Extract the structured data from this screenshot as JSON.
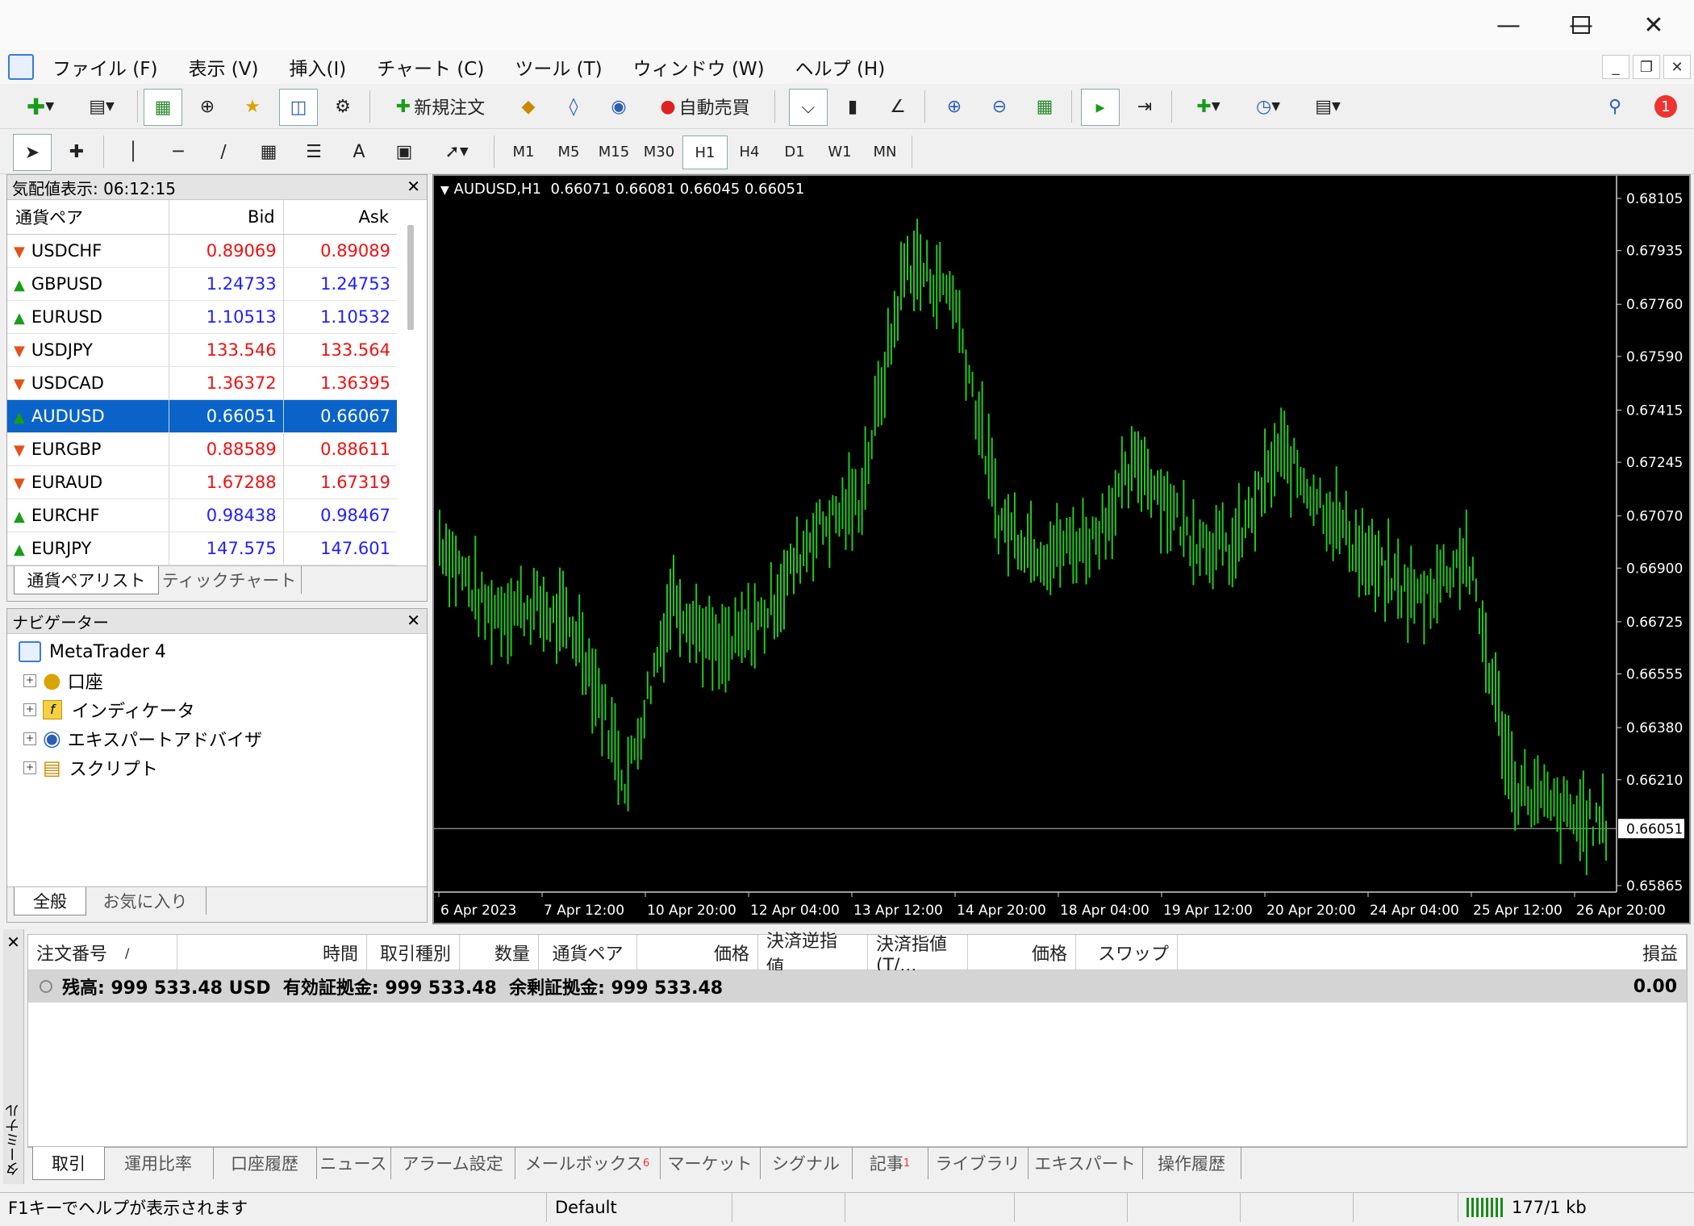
{
  "menu": [
    "ファイル (F)",
    "表示 (V)",
    "挿入(I)",
    "チャート (C)",
    "ツール (T)",
    "ウィンドウ (W)",
    "ヘルプ (H)"
  ],
  "toolbar": {
    "new_order": "新規注文",
    "auto_trade": "自動売買",
    "notification_count": "1",
    "timeframes": [
      "M1",
      "M5",
      "M15",
      "M30",
      "H1",
      "H4",
      "D1",
      "W1",
      "MN"
    ],
    "active_timeframe": "H1",
    "text_tool": "A"
  },
  "market_watch": {
    "title": "気配値表示: 06:12:15",
    "columns": [
      "通貨ペア",
      "Bid",
      "Ask"
    ],
    "rows": [
      {
        "symbol": "USDCHF",
        "bid": "0.89069",
        "ask": "0.89089",
        "dir": "down"
      },
      {
        "symbol": "GBPUSD",
        "bid": "1.24733",
        "ask": "1.24753",
        "dir": "up"
      },
      {
        "symbol": "EURUSD",
        "bid": "1.10513",
        "ask": "1.10532",
        "dir": "up"
      },
      {
        "symbol": "USDJPY",
        "bid": "133.546",
        "ask": "133.564",
        "dir": "down"
      },
      {
        "symbol": "USDCAD",
        "bid": "1.36372",
        "ask": "1.36395",
        "dir": "down"
      },
      {
        "symbol": "AUDUSD",
        "bid": "0.66051",
        "ask": "0.66067",
        "dir": "up",
        "selected": true
      },
      {
        "symbol": "EURGBP",
        "bid": "0.88589",
        "ask": "0.88611",
        "dir": "down"
      },
      {
        "symbol": "EURAUD",
        "bid": "1.67288",
        "ask": "1.67319",
        "dir": "down"
      },
      {
        "symbol": "EURCHF",
        "bid": "0.98438",
        "ask": "0.98467",
        "dir": "up"
      },
      {
        "symbol": "EURJPY",
        "bid": "147.575",
        "ask": "147.601",
        "dir": "up"
      }
    ],
    "tabs": [
      "通貨ペアリスト",
      "ティックチャート"
    ]
  },
  "navigator": {
    "title": "ナビゲーター",
    "root": "MetaTrader 4",
    "items": [
      "口座",
      "インディケータ",
      "エキスパートアドバイザ",
      "スクリプト"
    ],
    "tabs": [
      "全般",
      "お気に入り"
    ]
  },
  "chart": {
    "header": "AUDUSD,H1  0.66071 0.66081 0.66045 0.66051",
    "current_price": "0.66051",
    "price_labels": [
      "0.68105",
      "0.67935",
      "0.67760",
      "0.67590",
      "0.67415",
      "0.67245",
      "0.67070",
      "0.66900",
      "0.66725",
      "0.66555",
      "0.66380",
      "0.66210",
      "0.66051",
      "0.65865"
    ],
    "time_labels": [
      "6 Apr 2023",
      "7 Apr 12:00",
      "10 Apr 20:00",
      "12 Apr 04:00",
      "13 Apr 12:00",
      "14 Apr 20:00",
      "18 Apr 04:00",
      "19 Apr 12:00",
      "20 Apr 20:00",
      "24 Apr 04:00",
      "25 Apr 12:00",
      "26 Apr 20:00"
    ],
    "bar_color": "#22c822",
    "background": "#000000"
  },
  "chart_data": {
    "type": "line",
    "symbol": "AUDUSD",
    "timeframe": "H1",
    "ylim": [
      0.65865,
      0.68105
    ],
    "x": [
      "6 Apr 2023",
      "7 Apr 12:00",
      "10 Apr 20:00",
      "12 Apr 04:00",
      "13 Apr 12:00",
      "14 Apr 20:00",
      "18 Apr 04:00",
      "19 Apr 12:00",
      "20 Apr 20:00",
      "24 Apr 04:00",
      "25 Apr 12:00",
      "26 Apr 20:00"
    ],
    "series": [
      {
        "values": [
          0.67,
          0.6676,
          0.6678,
          0.6668,
          0.662,
          0.6682,
          0.6661,
          0.6675,
          0.6702,
          0.6712,
          0.679,
          0.678,
          0.6705,
          0.6695,
          0.67,
          0.6725,
          0.6702,
          0.6695,
          0.6728,
          0.671,
          0.669,
          0.668,
          0.6695,
          0.662,
          0.661,
          0.6606
        ]
      }
    ]
  },
  "terminal": {
    "side_label": "ターミナル",
    "columns": [
      "注文番号",
      "時間",
      "取引種別",
      "数量",
      "通貨ペア",
      "価格",
      "決済逆指値...",
      "決済指値(T/...",
      "価格",
      "スワップ",
      "損益"
    ],
    "sort_marker": "/",
    "balance_line": "残高: 999 533.48 USD  有効証拠金: 999 533.48  余剰証拠金: 999 533.48",
    "profit": "0.00",
    "tabs": [
      {
        "label": "取引"
      },
      {
        "label": "運用比率"
      },
      {
        "label": "口座履歴"
      },
      {
        "label": "ニュース"
      },
      {
        "label": "アラーム設定"
      },
      {
        "label": "メールボックス",
        "badge": "6"
      },
      {
        "label": "マーケット"
      },
      {
        "label": "シグナル"
      },
      {
        "label": "記事",
        "badge": "1"
      },
      {
        "label": "ライブラリ"
      },
      {
        "label": "エキスパート"
      },
      {
        "label": "操作履歴"
      }
    ]
  },
  "status": {
    "help": "F1キーでヘルプが表示されます",
    "profile": "Default",
    "traffic": "177/1 kb"
  },
  "colors": {
    "accent": "#0a63c9",
    "up": "#1f1fff",
    "down": "#f01010"
  }
}
